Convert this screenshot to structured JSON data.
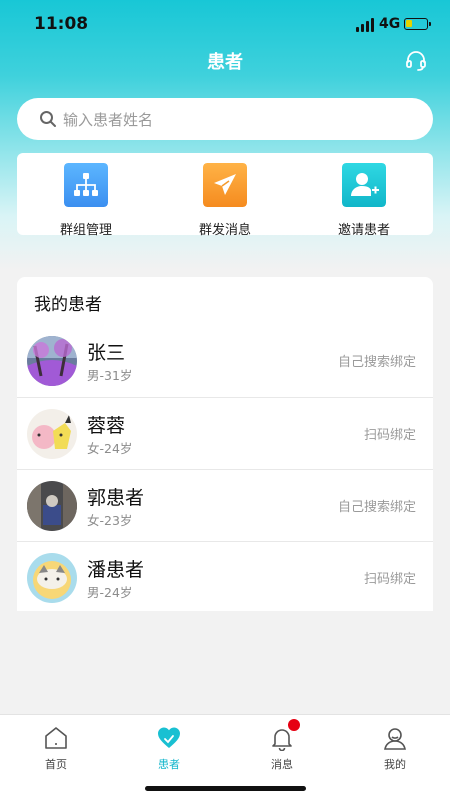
{
  "status_bar": {
    "time": "11:08",
    "network": "4G"
  },
  "header": {
    "title": "患者"
  },
  "search": {
    "placeholder": "输入患者姓名"
  },
  "actions": [
    {
      "label": "群组管理",
      "icon": "group-tree-icon",
      "color": "#4aa3f5"
    },
    {
      "label": "群发消息",
      "icon": "send-plane-icon",
      "color": "#f5a033"
    },
    {
      "label": "邀请患者",
      "icon": "add-user-icon",
      "color": "#19c6d6"
    }
  ],
  "patients": {
    "title": "我的患者",
    "items": [
      {
        "name": "张三",
        "info": "男-31岁",
        "binding": "自己搜索绑定"
      },
      {
        "name": "蓉蓉",
        "info": "女-24岁",
        "binding": "扫码绑定"
      },
      {
        "name": "郭患者",
        "info": "女-23岁",
        "binding": "自己搜索绑定"
      },
      {
        "name": "潘患者",
        "info": "男-24岁",
        "binding": "扫码绑定"
      }
    ]
  },
  "tabbar": {
    "tabs": [
      {
        "label": "首页",
        "icon": "home-icon"
      },
      {
        "label": "患者",
        "icon": "heart-icon",
        "active": true
      },
      {
        "label": "消息",
        "icon": "bell-icon",
        "badge": true
      },
      {
        "label": "我的",
        "icon": "user-icon"
      }
    ]
  },
  "colors": {
    "accent": "#19c6d6",
    "badge": "#e60012"
  }
}
